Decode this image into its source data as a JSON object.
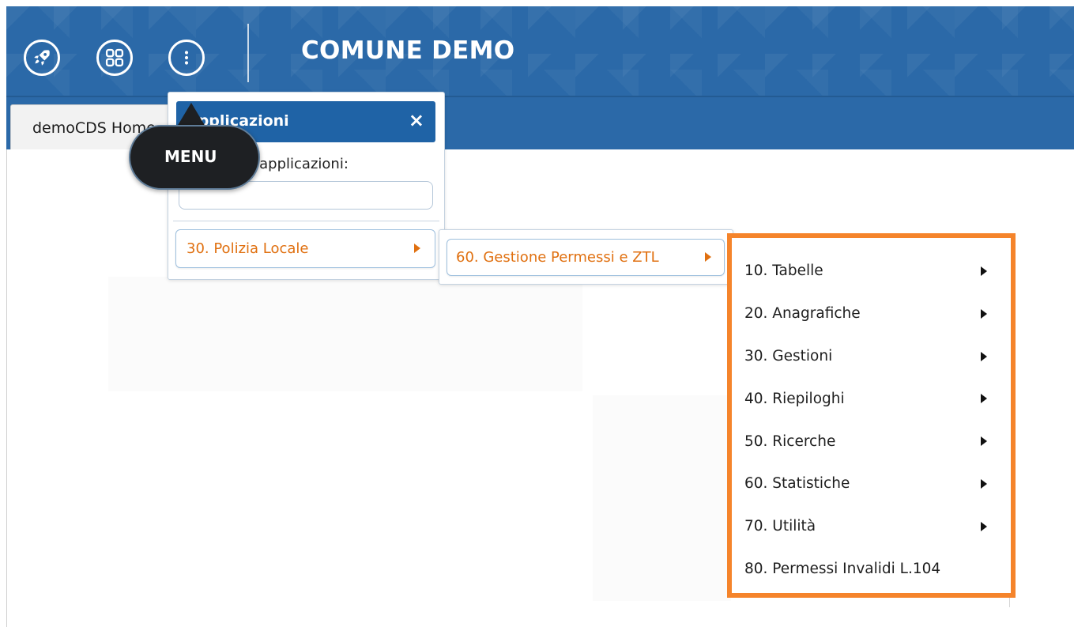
{
  "header": {
    "title": "COMUNE DEMO",
    "buttons": [
      {
        "icon": "rocket-icon"
      },
      {
        "icon": "apps-grid-icon"
      },
      {
        "icon": "more-vertical-icon"
      }
    ],
    "background_color": "#2b69a8"
  },
  "tabs": {
    "home_label": "demoCDS Home"
  },
  "apps_panel": {
    "title": "Applicazioni",
    "close_icon": "×",
    "search_label": "Ricerca applicazioni:",
    "search_value": "",
    "level1_item": "30. Polizia Locale"
  },
  "submenu": {
    "level2_item": "60. Gestione Permessi e ZTL"
  },
  "third_menu": {
    "highlight_color": "#f5842b",
    "items": [
      {
        "label": "10. Tabelle",
        "has_submenu": true
      },
      {
        "label": "20. Anagrafiche",
        "has_submenu": true
      },
      {
        "label": "30. Gestioni",
        "has_submenu": true
      },
      {
        "label": "40. Riepiloghi",
        "has_submenu": true
      },
      {
        "label": "50. Ricerche",
        "has_submenu": true
      },
      {
        "label": "60. Statistiche",
        "has_submenu": true
      },
      {
        "label": "70. Utilità",
        "has_submenu": true
      },
      {
        "label": "80. Permessi Invalidi L.104",
        "has_submenu": false
      }
    ]
  },
  "tooltip": {
    "label": "MENU"
  },
  "colors": {
    "accent_orange": "#e07010",
    "panel_header": "#1f63a6"
  }
}
